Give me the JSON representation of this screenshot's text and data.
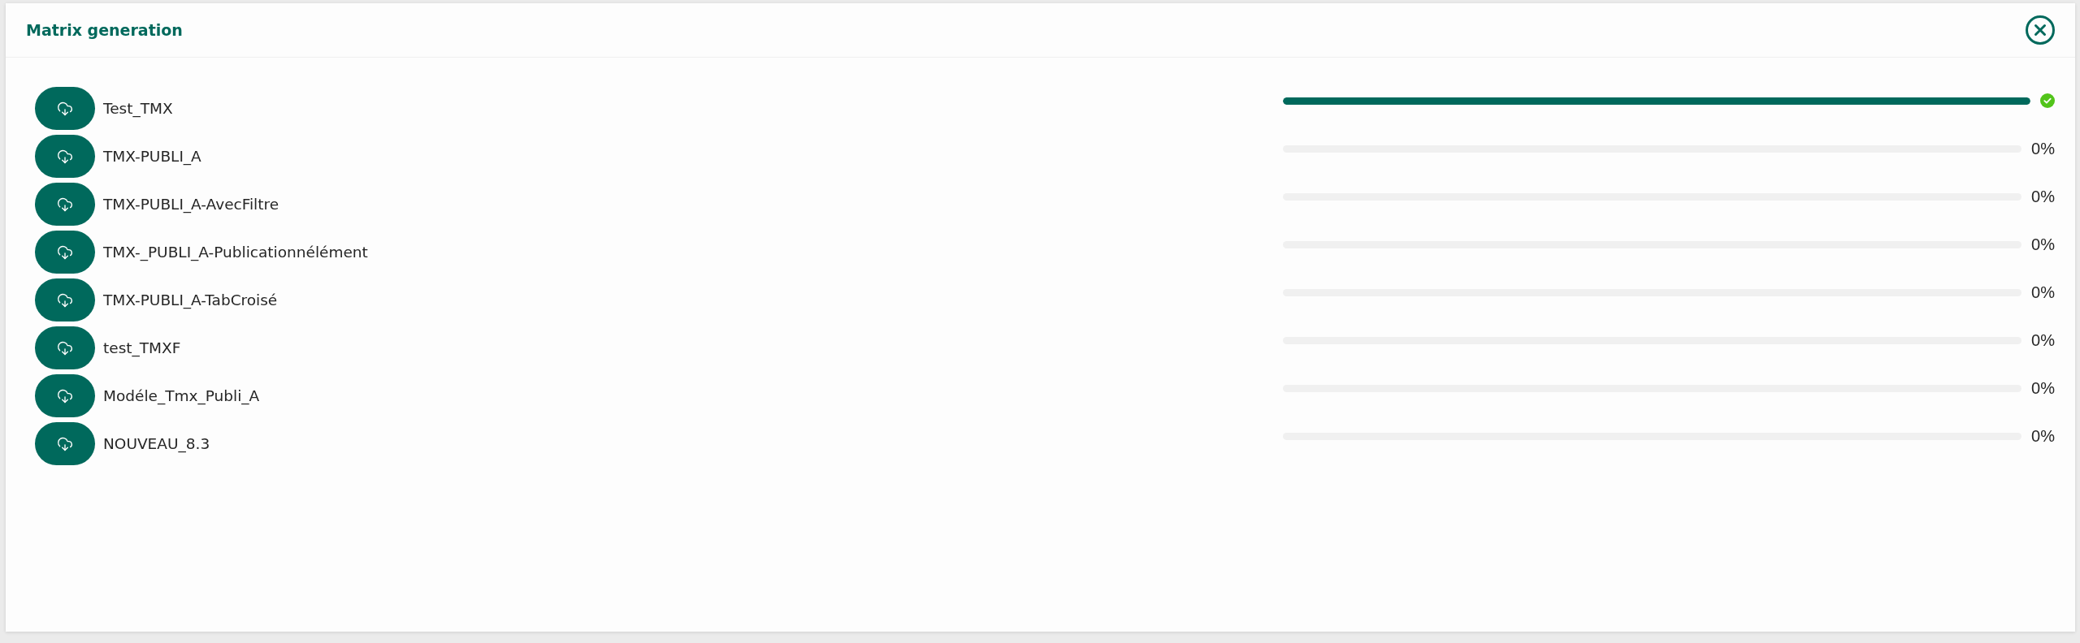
{
  "dialog": {
    "title": "Matrix generation"
  },
  "files": [
    {
      "name": "Test_TMX",
      "level": 1,
      "complete": true
    },
    {
      "name": "TMX-PUBLI_A",
      "level": 0,
      "complete": false,
      "percent": "0%"
    },
    {
      "name": "TMX-PUBLI_A-AvecFiltre",
      "level": 0,
      "complete": false,
      "percent": "0%"
    },
    {
      "name": "TMX-_PUBLI_A-Publicationnélément",
      "level": 0,
      "complete": false,
      "percent": "0%"
    },
    {
      "name": "TMX-PUBLI_A-TabCroisé",
      "level": 0,
      "complete": false,
      "percent": "0%"
    },
    {
      "name": "test_TMXF",
      "level": 0,
      "complete": false,
      "percent": "0%"
    },
    {
      "name": "Modéle_Tmx_Publi_A",
      "level": 0,
      "complete": false,
      "percent": "0%"
    },
    {
      "name": "NOUVEAU_8.3",
      "level": 0,
      "complete": false,
      "percent": "0%"
    }
  ]
}
